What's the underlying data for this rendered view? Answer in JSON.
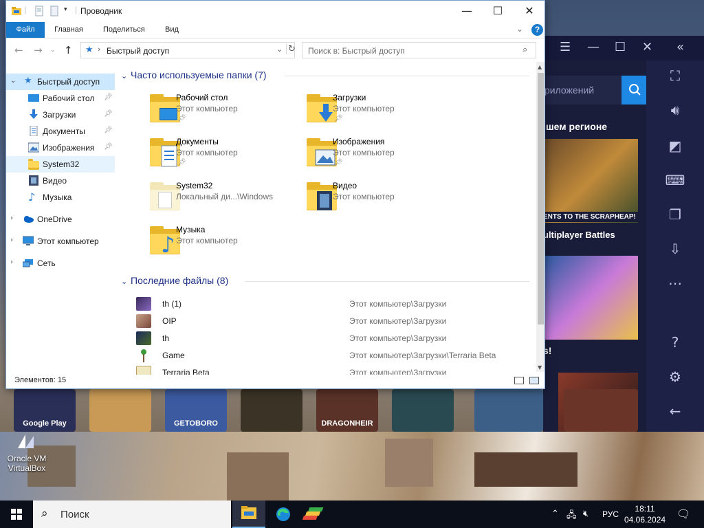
{
  "window": {
    "title": "Проводник",
    "controls": {
      "minimize": "—",
      "maximize": "☐",
      "close": "✕"
    }
  },
  "ribbon": {
    "tabs": [
      "Файл",
      "Главная",
      "Поделиться",
      "Вид"
    ],
    "help": "?"
  },
  "address": {
    "path": "Быстрый доступ",
    "search_placeholder": "Поиск в: Быстрый доступ"
  },
  "nav": {
    "quick_access": "Быстрый доступ",
    "pinned": [
      {
        "label": "Рабочий стол",
        "icon": "desktop-icon",
        "pinned": true
      },
      {
        "label": "Загрузки",
        "icon": "downloads-icon",
        "pinned": true
      },
      {
        "label": "Документы",
        "icon": "documents-icon",
        "pinned": true
      },
      {
        "label": "Изображения",
        "icon": "pictures-icon",
        "pinned": true
      },
      {
        "label": "System32",
        "icon": "folder-icon",
        "pinned": false
      },
      {
        "label": "Видео",
        "icon": "video-icon",
        "pinned": false
      },
      {
        "label": "Музыка",
        "icon": "music-icon",
        "pinned": false
      }
    ],
    "roots": [
      {
        "label": "OneDrive",
        "icon": "onedrive-icon"
      },
      {
        "label": "Этот компьютер",
        "icon": "computer-icon"
      },
      {
        "label": "Сеть",
        "icon": "network-icon"
      }
    ]
  },
  "frequent": {
    "header": "Часто используемые папки (7)",
    "folders": [
      {
        "name": "Рабочий стол",
        "location": "Этот компьютер",
        "pinned": true
      },
      {
        "name": "Загрузки",
        "location": "Этот компьютер",
        "pinned": true
      },
      {
        "name": "Документы",
        "location": "Этот компьютер",
        "pinned": true
      },
      {
        "name": "Изображения",
        "location": "Этот компьютер",
        "pinned": true
      },
      {
        "name": "System32",
        "location": "Локальный ди...\\Windows",
        "pinned": false
      },
      {
        "name": "Видео",
        "location": "Этот компьютер",
        "pinned": false
      },
      {
        "name": "Музыка",
        "location": "Этот компьютер",
        "pinned": false
      }
    ]
  },
  "recent": {
    "header": "Последние файлы (8)",
    "files": [
      {
        "name": "th (1)",
        "path": "Этот компьютер\\Загрузки",
        "thumb": "#5a4a8a"
      },
      {
        "name": "OIP",
        "path": "Этот компьютер\\Загрузки",
        "thumb": "#a0705a"
      },
      {
        "name": "th",
        "path": "Этот компьютер\\Загрузки",
        "thumb": "#2a3a6a"
      },
      {
        "name": "Game",
        "path": "Этот компьютер\\Загрузки\\Terraria Beta",
        "thumb": "#3d7a3a"
      },
      {
        "name": "Terraria Beta",
        "path": "Этот компьютер\\Загрузки",
        "thumb": "#d8c070"
      }
    ]
  },
  "status": {
    "items": "Элементов: 15"
  },
  "bluestacks": {
    "search_placeholder": "риложений",
    "region_heading": "шем регионе",
    "banner_caption": "ENTS TO THE SCRAPHEAP!",
    "subtitle": "ultiplayer Battles",
    "exclaim": "s!",
    "shelf": [
      {
        "label": "Google Play",
        "color": "#2a2f58"
      },
      {
        "label": "",
        "color": "#c89a55"
      },
      {
        "label": "GETOBORO",
        "color": "#3b5aa0"
      },
      {
        "label": "",
        "color": "#3a3326"
      },
      {
        "label": "DRAGONHEIR",
        "color": "#5a3228"
      },
      {
        "label": "",
        "color": "#2a4a52"
      },
      {
        "label": "",
        "color": "#3c5f88"
      },
      {
        "label": "",
        "color": "#6a3528"
      }
    ]
  },
  "desktop": {
    "icon_label": "Oracle VM VirtualBox"
  },
  "taskbar": {
    "search_label": "Поиск",
    "lang": "РУС",
    "time": "18:11",
    "date": "04.06.2024"
  },
  "colors": {
    "accent": "#1979ca",
    "selected": "#cce8ff",
    "folder": "#ffd75a"
  }
}
